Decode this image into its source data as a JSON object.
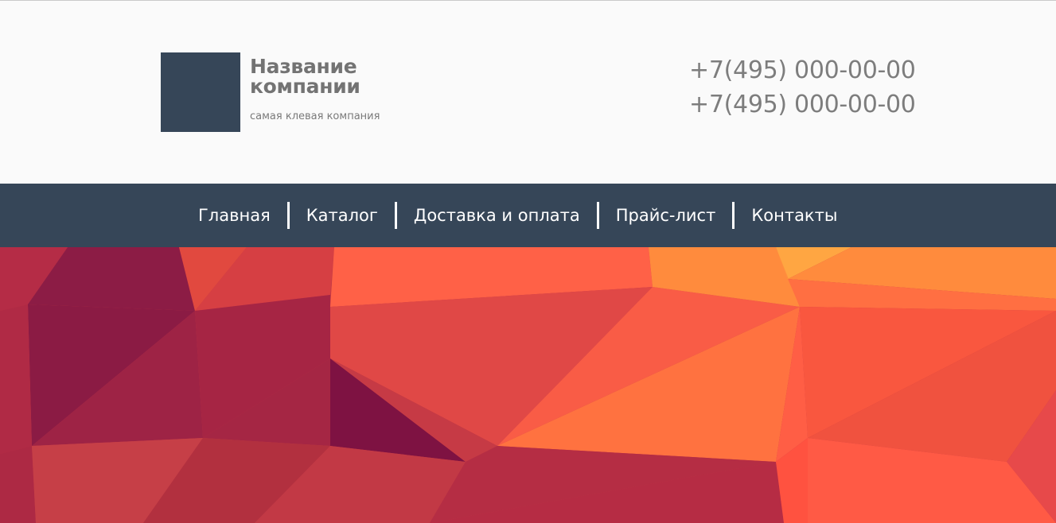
{
  "header": {
    "company_name": "Название компании",
    "tagline": "самая клевая компания",
    "phones": [
      "+7(495) 000-00-00",
      "+7(495) 000-00-00"
    ],
    "logo_color": "#364658"
  },
  "nav": {
    "items": [
      {
        "label": "Главная"
      },
      {
        "label": "Каталог"
      },
      {
        "label": "Доставка и оплата"
      },
      {
        "label": "Прайс-лист"
      },
      {
        "label": "Контакты"
      }
    ],
    "background": "#364658"
  },
  "hero": {
    "style": "low-poly geometric background",
    "colors": [
      "#8b1a42",
      "#c23a45",
      "#e04a45",
      "#ff6347",
      "#ff8c3c",
      "#ffa642"
    ]
  }
}
